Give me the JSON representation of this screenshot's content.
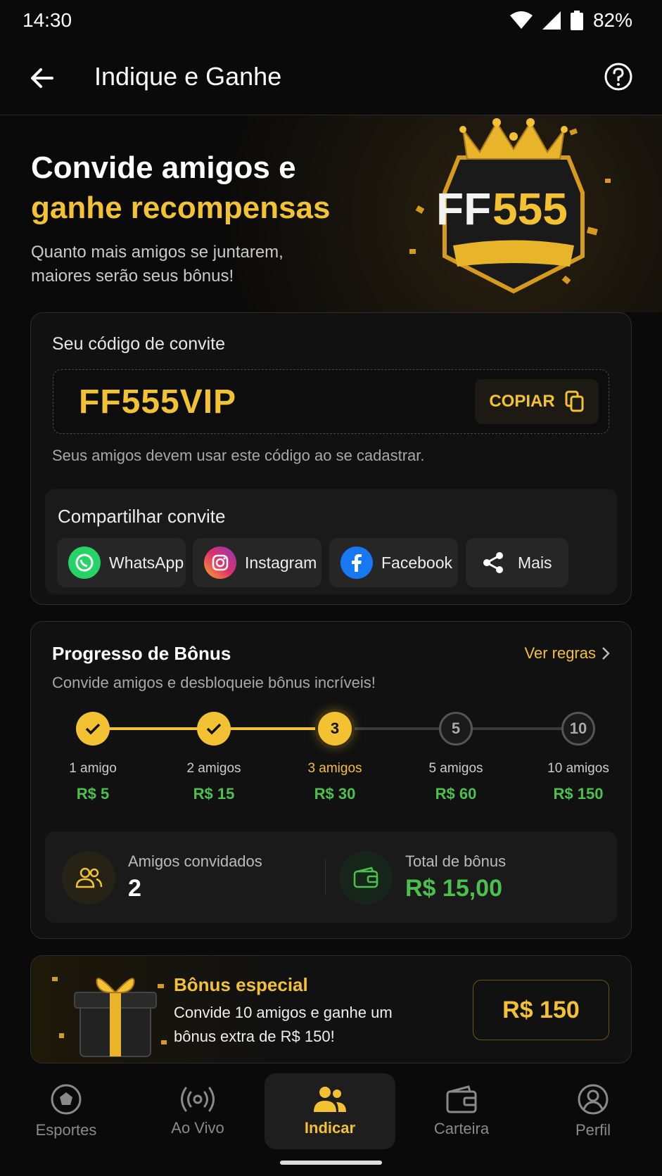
{
  "status_bar": {
    "time": "14:30",
    "battery": "82%"
  },
  "header": {
    "title": "Indique e Ganhe"
  },
  "hero": {
    "title_line1": "Convide amigos e",
    "title_line2": "ganhe recompensas",
    "subtitle": "Quanto mais amigos se juntarem, maiores serão seus bônus!",
    "logo_text_a": "FF",
    "logo_text_b": "555"
  },
  "invite": {
    "label": "Seu código de convite",
    "code": "FF555VIP",
    "copy_label": "COPIAR",
    "hint": "Seus amigos devem usar este código ao se cadastrar.",
    "share_title": "Compartilhar convite",
    "share_options": [
      {
        "label": "WhatsApp",
        "icon": "whatsapp-icon"
      },
      {
        "label": "Instagram",
        "icon": "instagram-icon"
      },
      {
        "label": "Facebook",
        "icon": "facebook-icon"
      },
      {
        "label": "Mais",
        "icon": "share-icon"
      }
    ]
  },
  "progress": {
    "title": "Progresso de Bônus",
    "rules_label": "Ver regras",
    "subtitle": "Convide amigos e desbloqueie bônus incríveis!",
    "progress_fraction": 0.5,
    "steps": [
      {
        "node": "",
        "label": "1 amigo",
        "reward": "R$ 5",
        "state": "done"
      },
      {
        "node": "",
        "label": "2 amigos",
        "reward": "R$ 15",
        "state": "done"
      },
      {
        "node": "3",
        "label": "3 amigos",
        "reward": "R$ 30",
        "state": "current"
      },
      {
        "node": "5",
        "label": "5 amigos",
        "reward": "R$ 60",
        "state": "locked"
      },
      {
        "node": "10",
        "label": "10 amigos",
        "reward": "R$ 150",
        "state": "locked"
      }
    ],
    "stats": {
      "friends_label": "Amigos convidados",
      "friends_value": "2",
      "bonus_label": "Total de bônus",
      "bonus_value": "R$ 15,00"
    }
  },
  "special_bonus": {
    "title": "Bônus especial",
    "description": "Convide 10 amigos e ganhe um bônus extra de R$ 150!",
    "amount": "R$ 150"
  },
  "bottom_nav": [
    {
      "label": "Esportes",
      "icon": "soccer-ball-icon",
      "active": false
    },
    {
      "label": "Ao Vivo",
      "icon": "broadcast-icon",
      "active": false
    },
    {
      "label": "Indicar",
      "icon": "users-icon",
      "active": true
    },
    {
      "label": "Carteira",
      "icon": "wallet-icon",
      "active": false
    },
    {
      "label": "Perfil",
      "icon": "profile-icon",
      "active": false
    }
  ],
  "colors": {
    "accent": "#f2c233",
    "success": "#4cc04c",
    "background": "#0a0a0a"
  }
}
